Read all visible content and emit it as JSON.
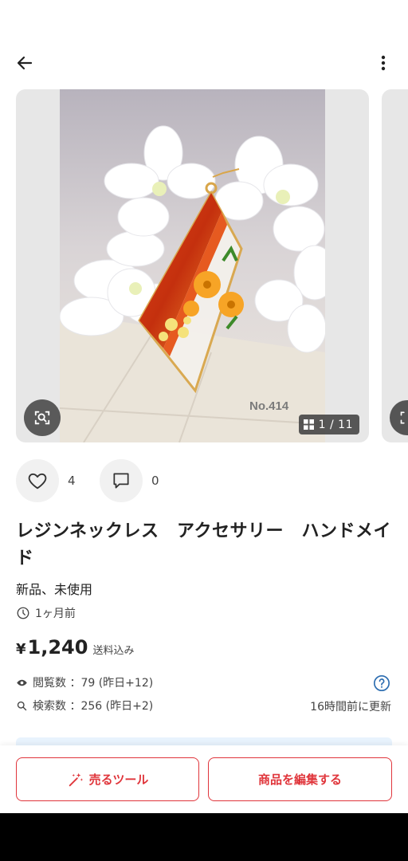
{
  "product": {
    "photo_label": "No.414",
    "image_counter": "1 / 11",
    "likes_count": "4",
    "comments_count": "0",
    "title": "レジンネックレス　アクセサリー　ハンドメイド",
    "condition": "新品、未使用",
    "posted_ago": "1ヶ月前",
    "price_currency": "¥",
    "price_value": "1,240",
    "price_note": "送料込み"
  },
  "stats": {
    "views": "閲覧数 ：79 (昨日+12)",
    "searches": "検索数 ：256 (昨日+2)",
    "updated": "16時間前に更新"
  },
  "buttons": {
    "sell_tools": "売るツール",
    "edit_item": "商品を編集する"
  },
  "colors": {
    "accent": "#e0353b",
    "info_blue": "#2b6cb0"
  }
}
